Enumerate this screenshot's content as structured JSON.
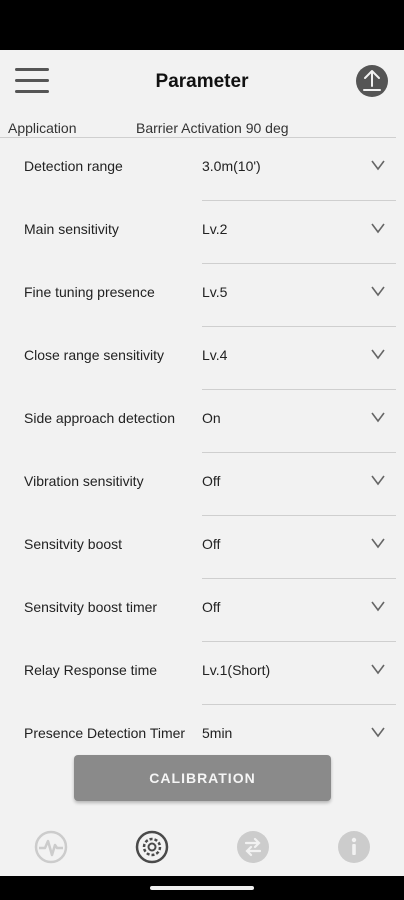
{
  "header": {
    "title": "Parameter"
  },
  "application": {
    "label": "Application",
    "value": "Barrier Activation 90 deg"
  },
  "params": [
    {
      "label": "Detection range",
      "value": "3.0m(10')"
    },
    {
      "label": "Main sensitivity",
      "value": "Lv.2"
    },
    {
      "label": "Fine tuning presence",
      "value": "Lv.5"
    },
    {
      "label": "Close range sensitivity",
      "value": "Lv.4"
    },
    {
      "label": "Side approach detection",
      "value": "On"
    },
    {
      "label": "Vibration sensitivity",
      "value": "Off"
    },
    {
      "label": "Sensitvity boost",
      "value": "Off"
    },
    {
      "label": "Sensitvity boost timer",
      "value": "Off"
    },
    {
      "label": "Relay Response time",
      "value": "Lv.1(Short)"
    },
    {
      "label": "Presence Detection Timer",
      "value": "5min"
    }
  ],
  "calibration": {
    "label": "CALIBRATION"
  },
  "nav": {
    "items": [
      {
        "icon": "waveform-icon",
        "active": false
      },
      {
        "icon": "gear-icon",
        "active": true
      },
      {
        "icon": "swap-icon",
        "active": false
      },
      {
        "icon": "info-icon",
        "active": false
      }
    ]
  },
  "colors": {
    "icon_active": "#4a4a4a",
    "icon_inactive": "#cccccc",
    "button_bg": "#8a8a8a"
  }
}
